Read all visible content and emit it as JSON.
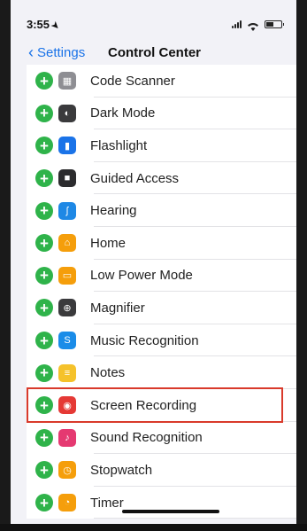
{
  "status": {
    "time": "3:55"
  },
  "nav": {
    "back_label": "Settings",
    "title": "Control Center"
  },
  "items": [
    {
      "label": "Code Scanner",
      "icon": "qr-scanner-icon",
      "color": "#8e8e93"
    },
    {
      "label": "Dark Mode",
      "icon": "dark-mode-icon",
      "color": "#3a3a3c"
    },
    {
      "label": "Flashlight",
      "icon": "flashlight-icon",
      "color": "#1a73e8"
    },
    {
      "label": "Guided Access",
      "icon": "lock-icon",
      "color": "#2c2c2e"
    },
    {
      "label": "Hearing",
      "icon": "ear-icon",
      "color": "#1e88e5"
    },
    {
      "label": "Home",
      "icon": "home-icon",
      "color": "#f59e0b"
    },
    {
      "label": "Low Power Mode",
      "icon": "battery-icon",
      "color": "#f59e0b"
    },
    {
      "label": "Magnifier",
      "icon": "magnifier-icon",
      "color": "#3a3a3c"
    },
    {
      "label": "Music Recognition",
      "icon": "shazam-icon",
      "color": "#1a8ce8"
    },
    {
      "label": "Notes",
      "icon": "notes-icon",
      "color": "#f5c22b"
    },
    {
      "label": "Screen Recording",
      "icon": "record-icon",
      "color": "#e53935"
    },
    {
      "label": "Sound Recognition",
      "icon": "sound-recognition-icon",
      "color": "#e53971"
    },
    {
      "label": "Stopwatch",
      "icon": "stopwatch-icon",
      "color": "#f59e0b"
    },
    {
      "label": "Timer",
      "icon": "timer-icon",
      "color": "#f59e0b"
    }
  ],
  "highlight_color": "#d93a2b"
}
